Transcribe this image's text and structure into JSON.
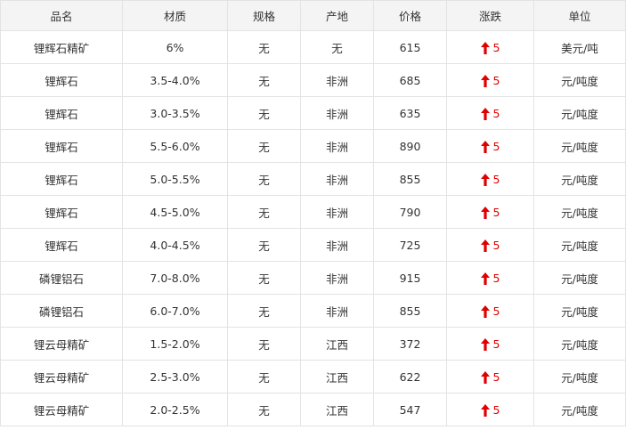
{
  "colors": {
    "header_bg": "#f4f4f4",
    "border": "#e3e3e3",
    "up": "#e00000",
    "text": "#333333"
  },
  "icons": {
    "change": "arrow-up-icon"
  },
  "columns": [
    "品名",
    "材质",
    "规格",
    "产地",
    "价格",
    "涨跌",
    "单位"
  ],
  "rows": [
    {
      "name": "锂辉石精矿",
      "grade": "6%",
      "spec": "无",
      "origin": "无",
      "price": "615",
      "change": "5",
      "unit": "美元/吨"
    },
    {
      "name": "锂辉石",
      "grade": "3.5-4.0%",
      "spec": "无",
      "origin": "非洲",
      "price": "685",
      "change": "5",
      "unit": "元/吨度"
    },
    {
      "name": "锂辉石",
      "grade": "3.0-3.5%",
      "spec": "无",
      "origin": "非洲",
      "price": "635",
      "change": "5",
      "unit": "元/吨度"
    },
    {
      "name": "锂辉石",
      "grade": "5.5-6.0%",
      "spec": "无",
      "origin": "非洲",
      "price": "890",
      "change": "5",
      "unit": "元/吨度"
    },
    {
      "name": "锂辉石",
      "grade": "5.0-5.5%",
      "spec": "无",
      "origin": "非洲",
      "price": "855",
      "change": "5",
      "unit": "元/吨度"
    },
    {
      "name": "锂辉石",
      "grade": "4.5-5.0%",
      "spec": "无",
      "origin": "非洲",
      "price": "790",
      "change": "5",
      "unit": "元/吨度"
    },
    {
      "name": "锂辉石",
      "grade": "4.0-4.5%",
      "spec": "无",
      "origin": "非洲",
      "price": "725",
      "change": "5",
      "unit": "元/吨度"
    },
    {
      "name": "磷锂铝石",
      "grade": "7.0-8.0%",
      "spec": "无",
      "origin": "非洲",
      "price": "915",
      "change": "5",
      "unit": "元/吨度"
    },
    {
      "name": "磷锂铝石",
      "grade": "6.0-7.0%",
      "spec": "无",
      "origin": "非洲",
      "price": "855",
      "change": "5",
      "unit": "元/吨度"
    },
    {
      "name": "锂云母精矿",
      "grade": "1.5-2.0%",
      "spec": "无",
      "origin": "江西",
      "price": "372",
      "change": "5",
      "unit": "元/吨度"
    },
    {
      "name": "锂云母精矿",
      "grade": "2.5-3.0%",
      "spec": "无",
      "origin": "江西",
      "price": "622",
      "change": "5",
      "unit": "元/吨度"
    },
    {
      "name": "锂云母精矿",
      "grade": "2.0-2.5%",
      "spec": "无",
      "origin": "江西",
      "price": "547",
      "change": "5",
      "unit": "元/吨度"
    }
  ]
}
